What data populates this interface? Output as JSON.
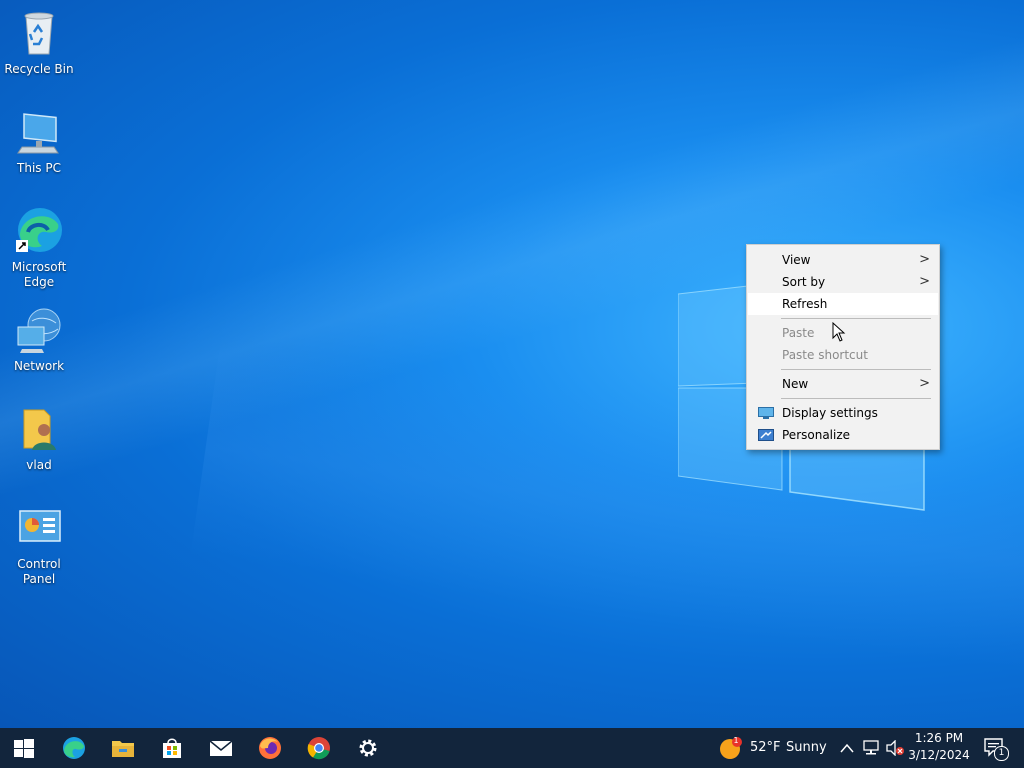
{
  "desktop": {
    "icons": [
      {
        "label": "Recycle Bin",
        "icon": "recycle-bin-icon"
      },
      {
        "label": "This PC",
        "icon": "this-pc-icon"
      },
      {
        "label": "Microsoft Edge",
        "icon": "edge-icon"
      },
      {
        "label": "Network",
        "icon": "network-icon"
      },
      {
        "label": "vlad",
        "icon": "user-folder-icon"
      },
      {
        "label": "Control Panel",
        "icon": "control-panel-icon"
      }
    ]
  },
  "context_menu": {
    "view": "View",
    "sort_by": "Sort by",
    "refresh": "Refresh",
    "paste": "Paste",
    "paste_shortcut": "Paste shortcut",
    "new": "New",
    "display_settings": "Display settings",
    "personalize": "Personalize",
    "submenu_arrow": ">"
  },
  "taskbar": {
    "apps": [
      "start-icon",
      "edge-icon",
      "file-explorer-icon",
      "store-icon",
      "mail-icon",
      "firefox-icon",
      "chrome-icon",
      "settings-icon"
    ],
    "weather": {
      "temp": "52°F",
      "condition": "Sunny",
      "badge": "1"
    },
    "clock": {
      "time": "1:26 PM",
      "date": "3/12/2024"
    },
    "notifications_count": "1"
  },
  "colors": {
    "accent": "#0a6fd6",
    "taskbar": "#12253c",
    "menu_bg": "#f2f2f2"
  }
}
